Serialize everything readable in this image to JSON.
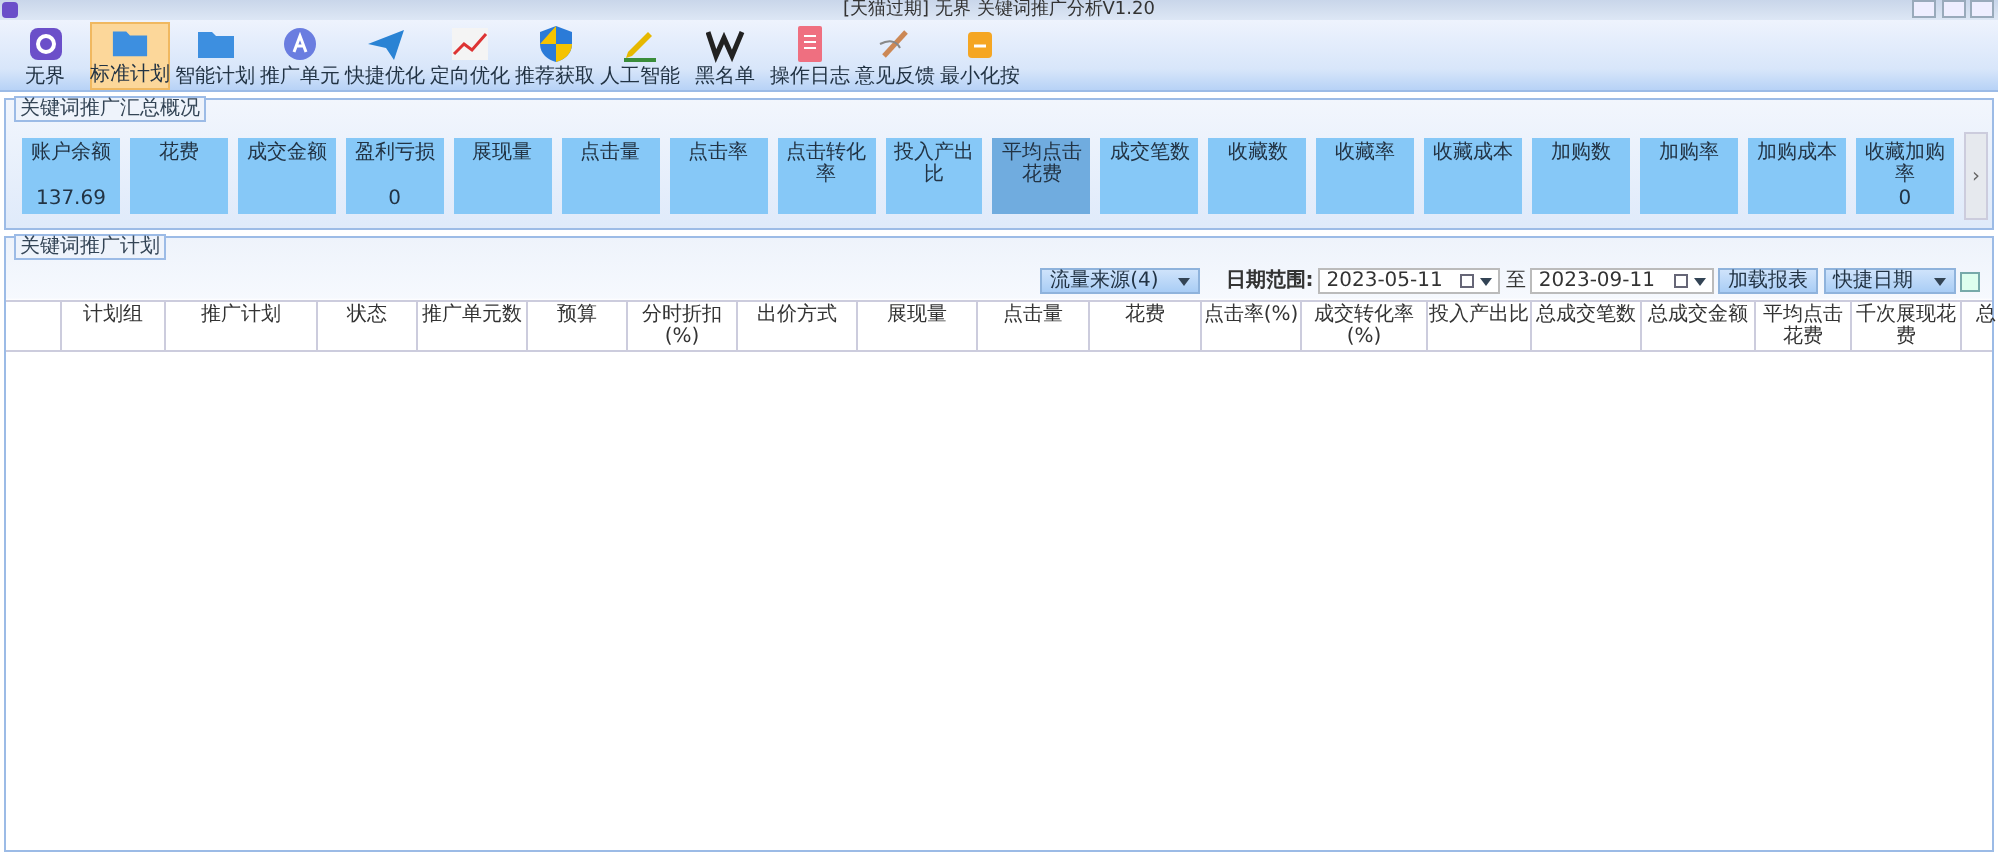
{
  "window": {
    "title": "[天猫过期] 无界 关键词推广分析V1.20"
  },
  "toolbar": [
    {
      "label": "无界",
      "kind": "circle",
      "selected": false
    },
    {
      "label": "标准计划",
      "kind": "folder",
      "selected": true
    },
    {
      "label": "智能计划",
      "kind": "folder",
      "selected": false
    },
    {
      "label": "推广单元",
      "kind": "badge",
      "selected": false
    },
    {
      "label": "快捷优化",
      "kind": "plane",
      "selected": false
    },
    {
      "label": "定向优化",
      "kind": "chart",
      "selected": false
    },
    {
      "label": "推荐获取",
      "kind": "shield",
      "selected": false
    },
    {
      "label": "人工智能",
      "kind": "pen",
      "selected": false
    },
    {
      "label": "黑名单",
      "kind": "w",
      "selected": false
    },
    {
      "label": "操作日志",
      "kind": "doc",
      "selected": false
    },
    {
      "label": "意见反馈",
      "kind": "brush",
      "selected": false
    },
    {
      "label": "最小化按",
      "kind": "mini",
      "selected": false
    }
  ],
  "summary": {
    "title": "关键词推广汇总概况",
    "cards": [
      {
        "label": "账户余额",
        "value": "137.69",
        "highlighted": false
      },
      {
        "label": "花费",
        "highlighted": false
      },
      {
        "label": "成交金额",
        "highlighted": false
      },
      {
        "label": "盈利亏损",
        "value": "0",
        "highlighted": false
      },
      {
        "label": "展现量",
        "highlighted": false
      },
      {
        "label": "点击量",
        "highlighted": false
      },
      {
        "label": "点击率",
        "highlighted": false
      },
      {
        "label": "点击转化率",
        "highlighted": false
      },
      {
        "label": "投入产出比",
        "highlighted": false
      },
      {
        "label": "平均点击花费",
        "highlighted": true
      },
      {
        "label": "成交笔数",
        "highlighted": false
      },
      {
        "label": "收藏数",
        "highlighted": false
      },
      {
        "label": "收藏率",
        "highlighted": false
      },
      {
        "label": "收藏成本",
        "highlighted": false
      },
      {
        "label": "加购数",
        "highlighted": false
      },
      {
        "label": "加购率",
        "highlighted": false
      },
      {
        "label": "加购成本",
        "highlighted": false
      },
      {
        "label": "收藏加购率",
        "value": "0",
        "highlighted": false
      }
    ],
    "scroll_button": "›"
  },
  "plans": {
    "title": "关键词推广计划",
    "source_dropdown": "流量来源(4)",
    "date_label": "日期范围:",
    "date_from": "2023-05-11",
    "date_sep": "至",
    "date_to": "2023-09-11",
    "load_button": "加载报表",
    "quick_dropdown": "快捷日期",
    "table": {
      "columns": [
        "",
        "计划组",
        "推广计划",
        "状态",
        "推广单元数",
        "预算",
        "分时折扣(%)",
        "出价方式",
        "展现量",
        "点击量",
        "花费",
        "点击率(%)",
        "成交转化率(%)",
        "投入产出比",
        "总成交笔数",
        "总成交金额",
        "平均点击花费",
        "千次展现花费",
        "总"
      ]
    }
  }
}
